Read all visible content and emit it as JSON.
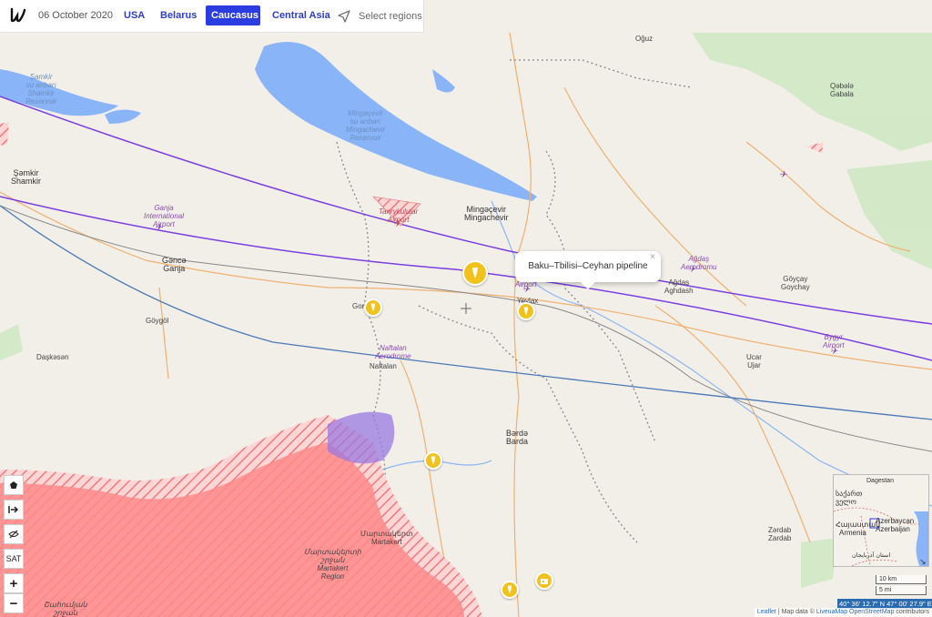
{
  "header": {
    "date": "06 October 2020",
    "nav": [
      {
        "label": "USA",
        "active": false
      },
      {
        "label": "Belarus",
        "active": false
      },
      {
        "label": "Caucasus",
        "active": true
      },
      {
        "label": "Central Asia",
        "active": false
      }
    ],
    "select_regions": "Select regions"
  },
  "popup": {
    "text": "Baku–Tbilisi–Ceyhan pipeline",
    "close": "×"
  },
  "labels": {
    "samkir_reservoir": [
      "Şamkir",
      "su anbarı",
      "Shamkir",
      "Reservoir"
    ],
    "mingachevir_reservoir": [
      "Mingəçevir",
      "su anbarı",
      "Mingachevir",
      "Reservoir"
    ],
    "samkir_town": [
      "Şəmkir",
      "Shamkir"
    ],
    "ganja_airport": [
      "Ganja",
      "International",
      "Airport"
    ],
    "ganja": [
      "Gəncə",
      "Ganja"
    ],
    "goygol": "Göygöl",
    "daskasan": "Daşkəsən",
    "tanrykulular": [
      "Tanrykulular",
      "Airport"
    ],
    "mingachevir": [
      "Mingəçevir",
      "Mingachevir"
    ],
    "yevlax": "Yevlax",
    "airport_yevlax": "Airport",
    "naftalan_aerodrome": [
      "Naftalan",
      "Aerodrome"
    ],
    "naftalan": "Naftalan",
    "gor": "Gor",
    "oguz": "Oğuz",
    "qabala": [
      "Qəbələ",
      "Gabala"
    ],
    "agdas_aerodrome": [
      "Ağdaş",
      "Aerodromu"
    ],
    "agdas": [
      "Ağdaş",
      "Aghdash"
    ],
    "goycay": [
      "Göyçay",
      "Goychay"
    ],
    "bygyr": [
      "Bygyr",
      "Airport"
    ],
    "ucar": [
      "Ucar",
      "Ujar"
    ],
    "barda": [
      "Bərdə",
      "Barda"
    ],
    "zardab": [
      "Zərdab",
      "Zardab"
    ],
    "martakert": [
      "Մարտակերտ",
      "Martakert"
    ],
    "martakert_region": [
      "Մարտակերտի",
      "շրջան",
      "Martakert",
      "Region"
    ],
    "shahumyan": [
      "Շահումյան",
      "շրջան"
    ]
  },
  "controls": {
    "sat": "SAT",
    "zoom_in": "+",
    "zoom_out": "−"
  },
  "minimap": {
    "labels": [
      "Dagestan",
      "საქართ",
      "ველო",
      "Azerbaycan",
      "Azerbaijan",
      "Հայաստան",
      "Armenia",
      "استان آذربایجان"
    ]
  },
  "scale": {
    "km": "10 km",
    "mi": "5 mi"
  },
  "coords": "40° 36' 12.7\" N 47° 00' 27.9\" E",
  "attribution": {
    "leaflet": "Leaflet",
    "mid": " | Map data © ",
    "liveua": "LiveuaMap",
    "osm": "OpenStreetMap",
    "end": " contributors"
  },
  "colors": {
    "accent": "#2b3de0",
    "marker": "#f2c21c",
    "occupied": "#ff8a8a",
    "water": "#8ab4f8",
    "pipeline": "#7a3ee0"
  }
}
